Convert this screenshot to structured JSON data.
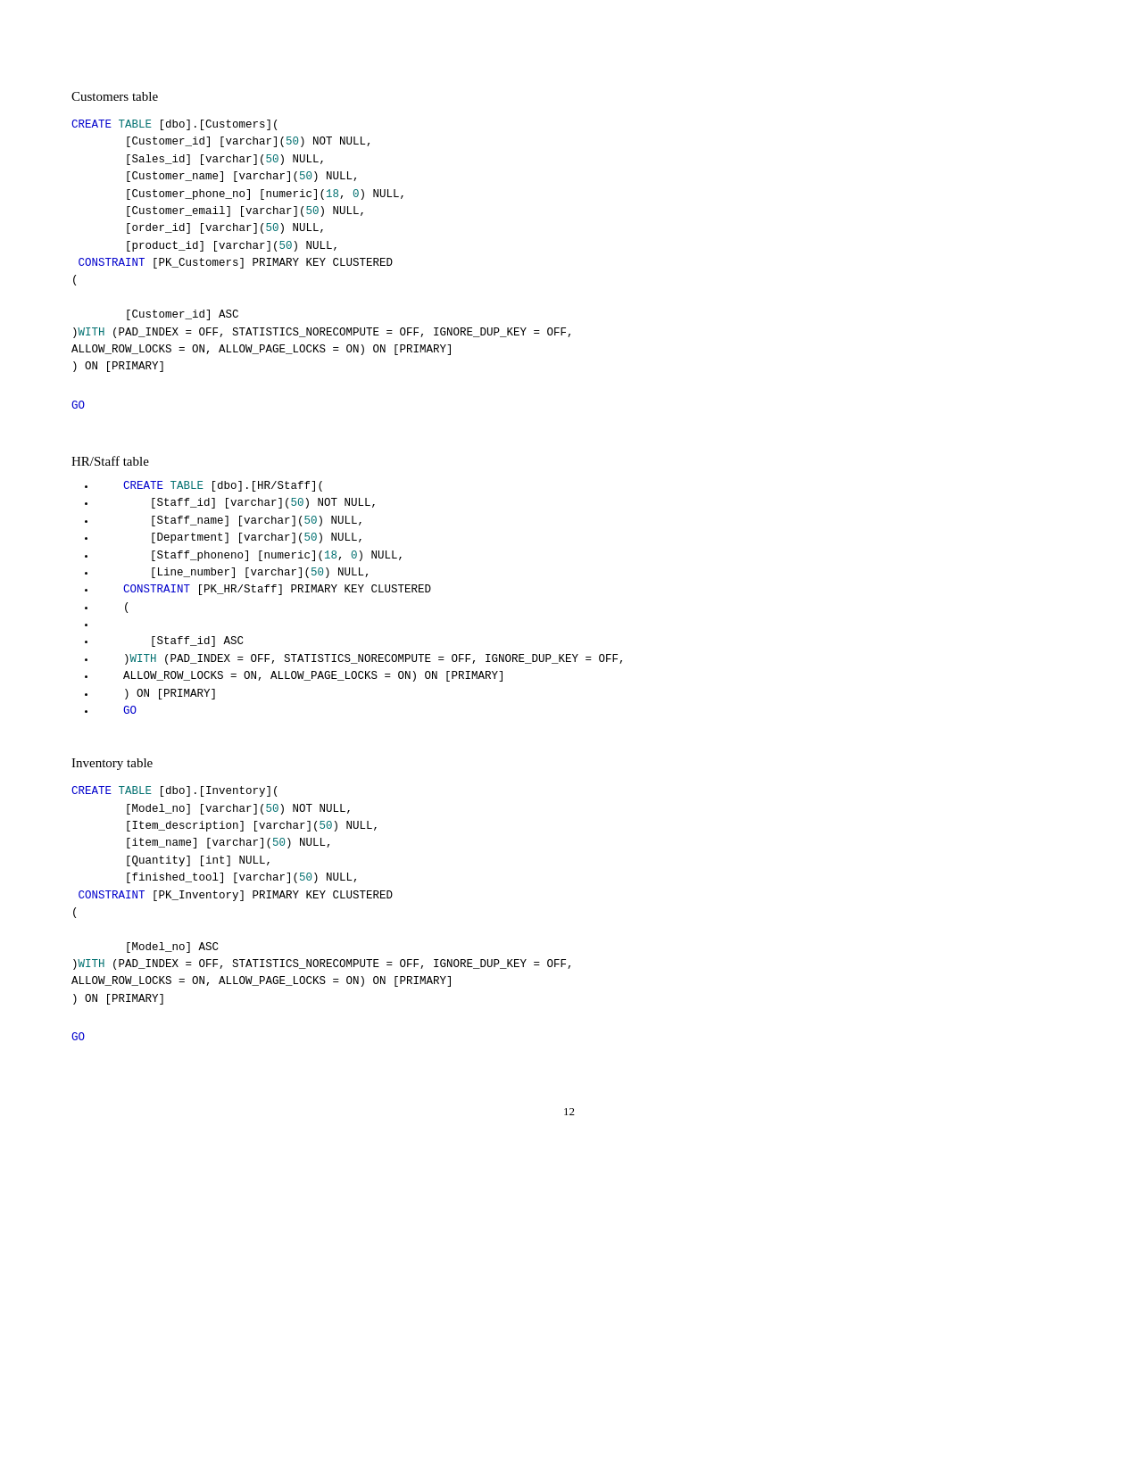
{
  "page": {
    "number": "12"
  },
  "sections": [
    {
      "id": "customers",
      "title": "Customers table",
      "type": "code",
      "code_lines": [
        {
          "text": "CREATE TABLE [dbo].[Customers](",
          "style": "blue-start"
        },
        {
          "text": "        [Customer_id] [varchar](50) NOT NULL,",
          "style": "normal"
        },
        {
          "text": "        [Sales_id] [varchar](50) NULL,",
          "style": "normal"
        },
        {
          "text": "        [Customer_name] [varchar](50) NULL,",
          "style": "normal"
        },
        {
          "text": "        [Customer_phone_no] [numeric](18, 0) NULL,",
          "style": "normal"
        },
        {
          "text": "        [Customer_email] [varchar](50) NULL,",
          "style": "normal"
        },
        {
          "text": "        [order_id] [varchar](50) NULL,",
          "style": "normal"
        },
        {
          "text": "        [product_id] [varchar](50) NULL,",
          "style": "normal"
        },
        {
          "text": " CONSTRAINT [PK_Customers] PRIMARY KEY CLUSTERED",
          "style": "constraint"
        },
        {
          "text": "(",
          "style": "normal"
        },
        {
          "text": "",
          "style": "blank"
        },
        {
          "text": "        [Customer_id] ASC",
          "style": "normal"
        },
        {
          "text": ")WITH (PAD_INDEX = OFF, STATISTICS_NORECOMPUTE = OFF, IGNORE_DUP_KEY = OFF,",
          "style": "with"
        },
        {
          "text": "ALLOW_ROW_LOCKS = ON, ALLOW_PAGE_LOCKS = ON) ON [PRIMARY]",
          "style": "normal"
        },
        {
          "text": ") ON [PRIMARY]",
          "style": "normal"
        }
      ],
      "go": "GO"
    },
    {
      "id": "hrstaff",
      "title": "HR/Staff table",
      "type": "bullets",
      "bullets": [
        "    CREATE TABLE [dbo].[HR/Staff](",
        "        [Staff_id] [varchar](50) NOT NULL,",
        "        [Staff_name] [varchar](50) NULL,",
        "        [Department] [varchar](50) NULL,",
        "        [Staff_phoneno] [numeric](18, 0) NULL,",
        "        [Line_number] [varchar](50) NULL,",
        "    CONSTRAINT [PK_HR/Staff] PRIMARY KEY CLUSTERED",
        "    (",
        "",
        "        [Staff_id] ASC",
        "    )WITH (PAD_INDEX = OFF, STATISTICS_NORECOMPUTE = OFF, IGNORE_DUP_KEY = OFF,",
        "    ALLOW_ROW_LOCKS = ON, ALLOW_PAGE_LOCKS = ON) ON [PRIMARY]",
        "    ) ON [PRIMARY]",
        "    GO"
      ],
      "bullet_styles": [
        "blue-create",
        "normal",
        "normal",
        "normal",
        "normal",
        "normal",
        "constraint",
        "normal",
        "blank",
        "normal",
        "with",
        "normal",
        "normal",
        "go"
      ]
    },
    {
      "id": "inventory",
      "title": "Inventory table",
      "type": "code",
      "code_lines": [
        {
          "text": "CREATE TABLE [dbo].[Inventory](",
          "style": "blue-start"
        },
        {
          "text": "        [Model_no] [varchar](50) NOT NULL,",
          "style": "normal"
        },
        {
          "text": "        [Item_description] [varchar](50) NULL,",
          "style": "normal"
        },
        {
          "text": "        [item_name] [varchar](50) NULL,",
          "style": "normal"
        },
        {
          "text": "        [Quantity] [int] NULL,",
          "style": "normal"
        },
        {
          "text": "        [finished_tool] [varchar](50) NULL,",
          "style": "normal"
        },
        {
          "text": " CONSTRAINT [PK_Inventory] PRIMARY KEY CLUSTERED",
          "style": "constraint"
        },
        {
          "text": "(",
          "style": "normal"
        },
        {
          "text": "",
          "style": "blank"
        },
        {
          "text": "        [Model_no] ASC",
          "style": "normal"
        },
        {
          "text": ")WITH (PAD_INDEX = OFF, STATISTICS_NORECOMPUTE = OFF, IGNORE_DUP_KEY = OFF,",
          "style": "with"
        },
        {
          "text": "ALLOW_ROW_LOCKS = ON, ALLOW_PAGE_LOCKS = ON) ON [PRIMARY]",
          "style": "normal"
        },
        {
          "text": ") ON [PRIMARY]",
          "style": "normal"
        }
      ],
      "go": "GO"
    }
  ]
}
